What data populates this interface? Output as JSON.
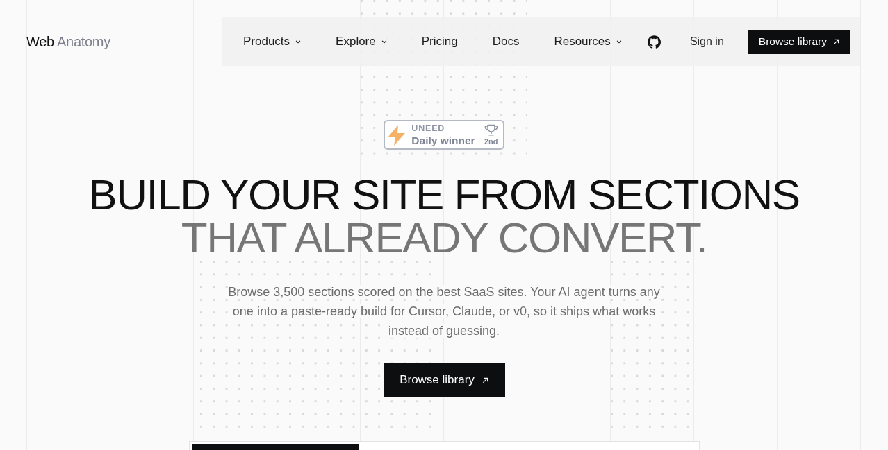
{
  "header": {
    "logo": {
      "primary": "Web",
      "secondary": "Anatomy"
    },
    "nav": [
      {
        "label": "Products",
        "has_menu": true
      },
      {
        "label": "Explore",
        "has_menu": true
      },
      {
        "label": "Pricing",
        "has_menu": false
      },
      {
        "label": "Docs",
        "has_menu": false
      },
      {
        "label": "Resources",
        "has_menu": true
      }
    ],
    "sign_in": "Sign in",
    "cta": "Browse library"
  },
  "hero": {
    "badge": {
      "brand": "UNEED",
      "title": "Daily winner",
      "rank": "2nd"
    },
    "headline": [
      {
        "text": "BUILD YOUR SITE FROM SECTIONS",
        "muted": false
      },
      {
        "text": "THAT ALREADY CONVERT.",
        "muted": true
      }
    ],
    "description": "Browse 3,500 sections scored on the best SaaS sites. Your AI agent turns any one into a paste-ready build for Cursor, Claude, or v0, so it ships what works instead of guessing.",
    "cta": "Browse library"
  }
}
